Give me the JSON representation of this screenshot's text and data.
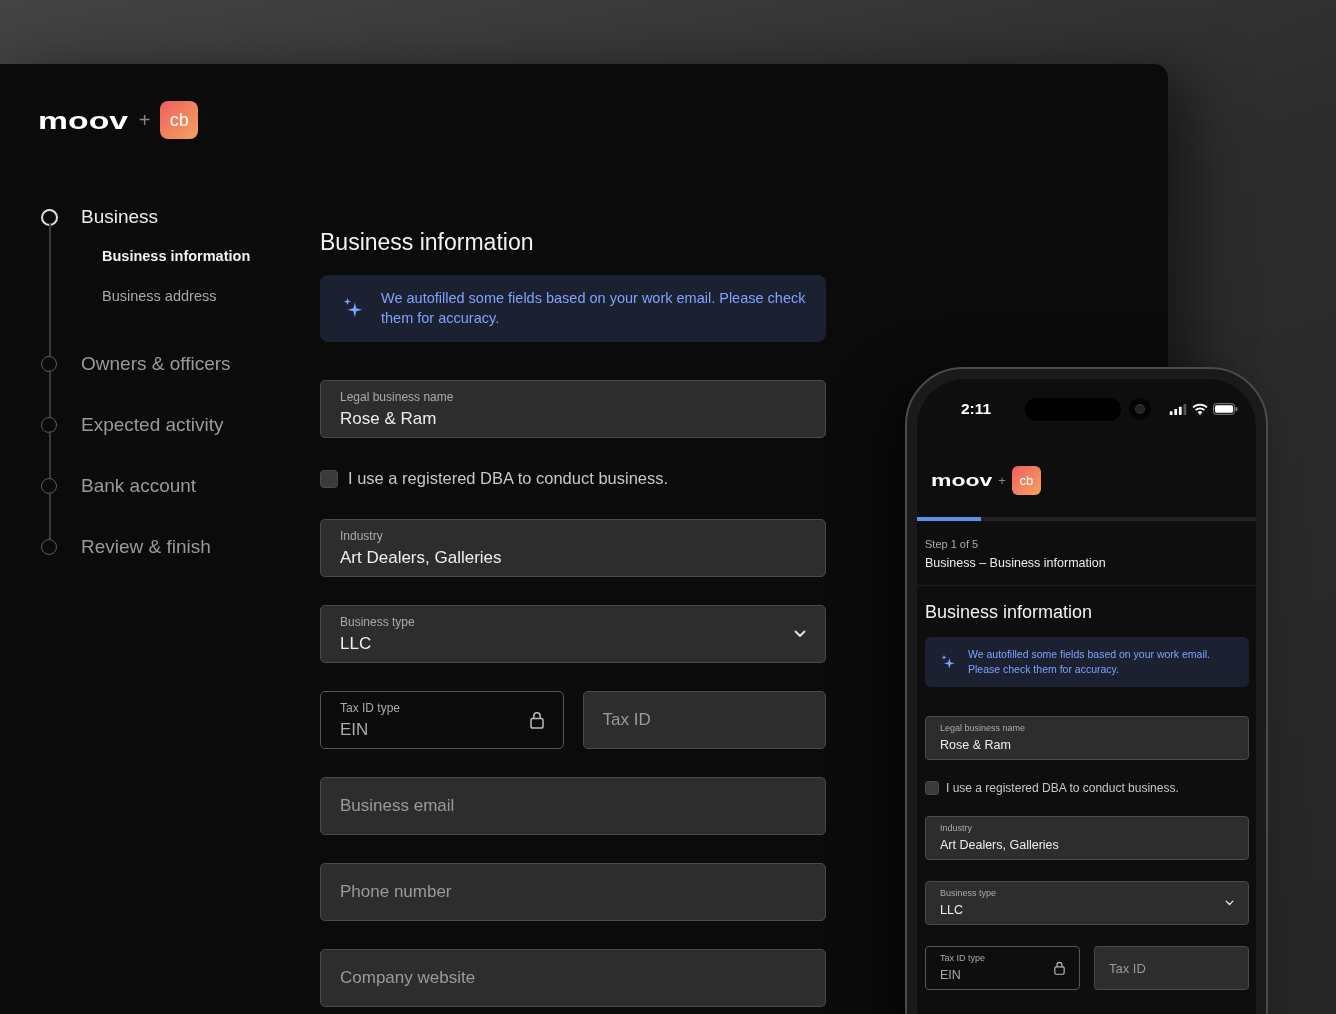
{
  "desktop": {
    "logo": {
      "brand": "moov",
      "plus": "+",
      "partner": "cb"
    },
    "steps": [
      {
        "label": "Business",
        "selected": true,
        "children": [
          {
            "label": "Business information",
            "selected": true
          },
          {
            "label": "Business address",
            "selected": false
          }
        ]
      },
      {
        "label": "Owners & officers",
        "selected": false
      },
      {
        "label": "Expected activity",
        "selected": false
      },
      {
        "label": "Bank account",
        "selected": false
      },
      {
        "label": "Review & finish",
        "selected": false
      }
    ],
    "form": {
      "title": "Business information",
      "notice": "We autofilled some fields based on your work email. Please check them for accuracy.",
      "fields": [
        {
          "kind": "text",
          "label": "Legal business name",
          "value": "Rose & Ram"
        },
        {
          "kind": "checkbox",
          "label": "I use a registered DBA to conduct business.",
          "checked": false
        },
        {
          "kind": "text",
          "label": "Industry",
          "value": "Art Dealers, Galleries"
        },
        {
          "kind": "select",
          "label": "Business type",
          "value": "LLC"
        },
        {
          "kind": "row",
          "items": [
            {
              "kind": "locked",
              "label": "Tax ID type",
              "value": "EIN"
            },
            {
              "kind": "text",
              "placeholder": "Tax ID"
            }
          ]
        },
        {
          "kind": "text",
          "placeholder": "Business email"
        },
        {
          "kind": "text",
          "placeholder": "Phone number"
        },
        {
          "kind": "text",
          "placeholder": "Company website"
        }
      ]
    }
  },
  "phone": {
    "status_bar": {
      "time": "2:11"
    },
    "logo": {
      "brand": "moov",
      "plus": "+",
      "partner": "cb"
    },
    "progress": {
      "level": 0.19
    },
    "step": "Step 1 of 5",
    "step_title": "Business – Business information",
    "form": {
      "title": "Business information",
      "notice": "We autofilled some fields based on your work email. Please check them for accuracy.",
      "fields": [
        {
          "kind": "text",
          "label": "Legal business name",
          "value": "Rose & Ram"
        },
        {
          "kind": "checkbox",
          "label": "I use a registered DBA to conduct business.",
          "checked": false
        },
        {
          "kind": "text",
          "label": "Industry",
          "value": "Art Dealers, Galleries"
        },
        {
          "kind": "select",
          "label": "Business type",
          "value": "LLC"
        },
        {
          "kind": "row",
          "items": [
            {
              "kind": "locked",
              "label": "Tax ID type",
              "value": "EIN"
            },
            {
              "kind": "text",
              "placeholder": "Tax ID"
            }
          ]
        }
      ]
    }
  }
}
